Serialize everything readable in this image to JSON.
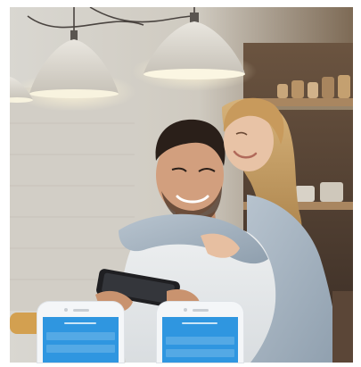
{
  "image": {
    "subject": "couple-using-phone-in-kitchen"
  },
  "colors": {
    "app_blue": "#2f96e0",
    "phone_body": "#f4f6f8"
  },
  "phones": [
    {
      "icon": "smartphone-icon"
    },
    {
      "icon": "smartphone-icon"
    }
  ]
}
